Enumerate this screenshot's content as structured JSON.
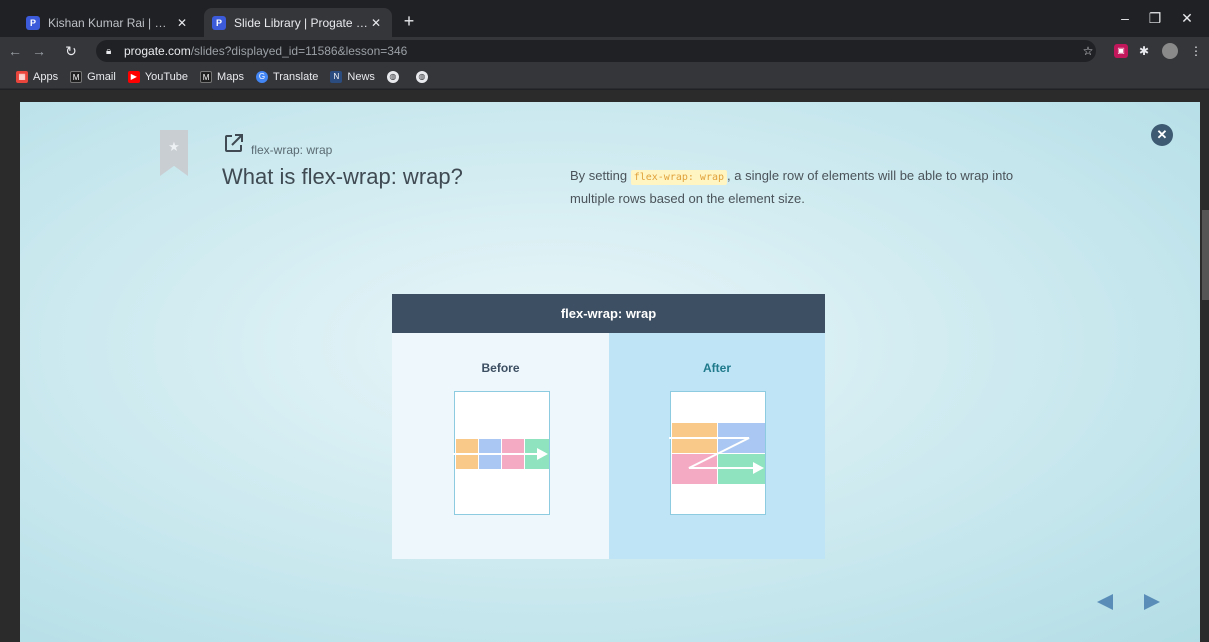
{
  "browser": {
    "tabs": [
      {
        "title": "Kishan Kumar Rai | Progate - Lea",
        "favicon": "P",
        "active": false
      },
      {
        "title": "Slide Library | Progate - Learn to",
        "favicon": "P",
        "active": true
      }
    ],
    "url_host": "progate.com",
    "url_path": "/slides?displayed_id=11586&lesson=346",
    "bookmarks": [
      {
        "label": "Apps",
        "icon": "apps-grid-icon",
        "color": "#e8453c"
      },
      {
        "label": "Gmail",
        "icon": "gmail-icon",
        "color": "#2b2b2b"
      },
      {
        "label": "YouTube",
        "icon": "youtube-icon",
        "color": "#ff0000"
      },
      {
        "label": "Maps",
        "icon": "maps-icon",
        "color": "#2b2b2b"
      },
      {
        "label": "Translate",
        "icon": "translate-icon",
        "color": "#4285f4"
      },
      {
        "label": "News",
        "icon": "news-icon",
        "color": "#2b4c7e"
      }
    ]
  },
  "slide": {
    "topic": "flex-wrap: wrap",
    "title": "What is flex-wrap: wrap?",
    "description_prefix": "By setting ",
    "description_code": "flex-wrap: wrap",
    "description_suffix": ", a single row of elements will be able to wrap into multiple rows based on the element size."
  },
  "illustration": {
    "header": "flex-wrap: wrap",
    "before_label": "Before",
    "after_label": "After",
    "colors": {
      "orange": "#f9c98a",
      "blue": "#a9c7f2",
      "pink": "#f5aac3",
      "green": "#8fe3bf",
      "header_bg": "#3d4f62",
      "accent": "#1f7a8c"
    }
  },
  "nav": {
    "close_icon": "close-circle-icon",
    "prev_icon": "triangle-left-icon",
    "next_icon": "triangle-right-icon"
  }
}
